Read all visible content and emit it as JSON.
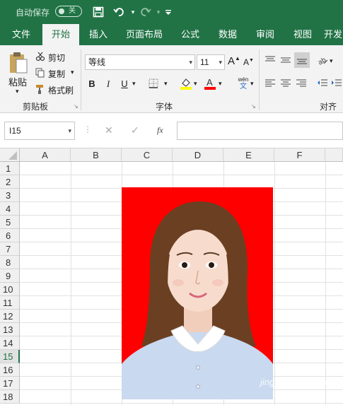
{
  "titlebar": {
    "autosave_label": "自动保存",
    "autosave_state": "关",
    "icons": [
      "save-icon",
      "undo-icon",
      "redo-icon",
      "customize-quick-access-icon"
    ]
  },
  "tabs": [
    {
      "label": "文件"
    },
    {
      "label": "开始",
      "active": true
    },
    {
      "label": "插入"
    },
    {
      "label": "页面布局"
    },
    {
      "label": "公式"
    },
    {
      "label": "数据"
    },
    {
      "label": "审阅"
    },
    {
      "label": "视图"
    },
    {
      "label": "开发"
    }
  ],
  "ribbon": {
    "clipboard": {
      "paste_label": "粘贴",
      "cut_label": "剪切",
      "copy_label": "复制",
      "format_painter_label": "格式刷",
      "group_label": "剪贴板"
    },
    "font": {
      "font_name": "等线",
      "font_size": "11",
      "bold": "B",
      "italic": "I",
      "underline": "U",
      "phonetic": "wén",
      "phonetic_sub": "文",
      "grow": "A",
      "shrink": "A",
      "group_label": "字体"
    },
    "alignment": {
      "group_label": "对齐方"
    }
  },
  "formula_bar": {
    "cell_ref": "I15",
    "fx_label": "fx",
    "formula_value": ""
  },
  "sheet": {
    "columns": [
      "A",
      "B",
      "C",
      "D",
      "E",
      "F"
    ],
    "rows": [
      "1",
      "2",
      "3",
      "4",
      "5",
      "6",
      "7",
      "8",
      "9",
      "10",
      "11",
      "12",
      "13",
      "14",
      "15",
      "16",
      "17",
      "18"
    ],
    "active_row": "15"
  },
  "photo": {
    "background_color": "#ff0000",
    "watermark": "jingyan.baidu.com"
  },
  "colors": {
    "brand_green": "#217346",
    "highlight_yellow": "#ffff00",
    "font_red": "#ff0000"
  }
}
